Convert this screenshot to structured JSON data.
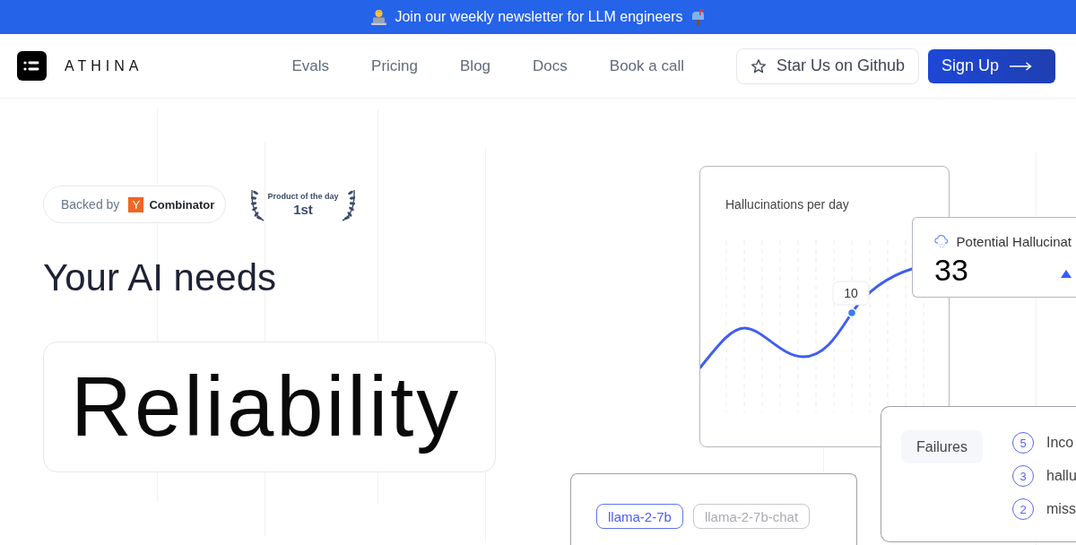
{
  "banner": {
    "text": "Join our weekly newsletter for LLM engineers"
  },
  "nav": {
    "brand": "ATHINA",
    "links": [
      "Evals",
      "Pricing",
      "Blog",
      "Docs",
      "Book a call"
    ],
    "star_button": "Star Us on Github",
    "signup_button": "Sign Up"
  },
  "hero": {
    "backed_by": {
      "label": "Backed by",
      "logo_letter": "Y",
      "company": "Combinator"
    },
    "award": {
      "title": "Product of the day",
      "rank": "1st"
    },
    "heading": "Your AI needs",
    "highlight": "Reliability"
  },
  "chart_card": {
    "title": "Hallucinations per day",
    "tooltip": "10"
  },
  "metric_card": {
    "label": "Potential Hallucinat",
    "value": "33"
  },
  "failures_card": {
    "tab": "Failures",
    "items": [
      {
        "count": "5",
        "label": "Inco"
      },
      {
        "count": "3",
        "label": "hallu"
      },
      {
        "count": "2",
        "label": "miss"
      }
    ]
  },
  "models_card": {
    "models": [
      {
        "label": "llama-2-7b",
        "selected": true
      },
      {
        "label": "llama-2-7b-chat",
        "selected": false
      }
    ]
  }
}
